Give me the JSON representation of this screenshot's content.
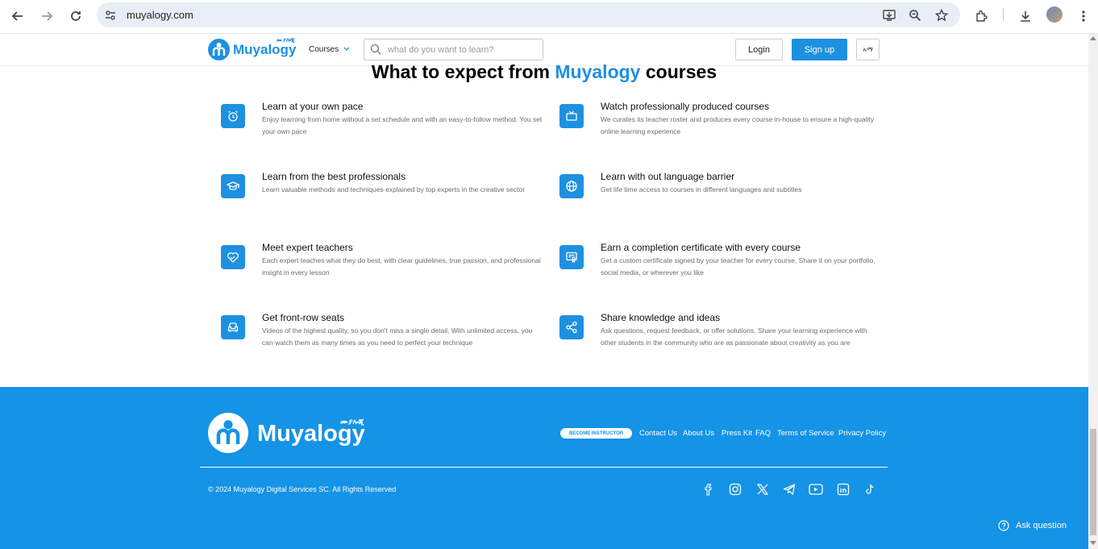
{
  "browser": {
    "url": "muyalogy.com"
  },
  "header": {
    "logo_text": "Muyalogy",
    "logo_subtext": "ሙያሎጂ",
    "courses_label": "Courses",
    "search_placeholder": "what do you want to learn?",
    "login_label": "Login",
    "signup_label": "Sign up",
    "language_label": "አማ"
  },
  "section": {
    "title_prefix": "What to expect from ",
    "title_accent": "Muyalogy",
    "title_suffix": " courses"
  },
  "features": [
    {
      "icon": "alarm-clock-icon",
      "title": "Learn at your own pace",
      "desc": "Enjoy learning from home without a set schedule and with an easy-to-follow method. You set your own pace"
    },
    {
      "icon": "tv-icon",
      "title": "Watch professionally produced courses",
      "desc": "We curates its teacher roster and produces every course in-house to ensure a high-quality online learning experience"
    },
    {
      "icon": "graduation-cap-icon",
      "title": "Learn from the best professionals",
      "desc": "Learn valuable methods and techniques explained by top experts in the creative sector"
    },
    {
      "icon": "globe-icon",
      "title": "Learn with out language barrier",
      "desc": "Get life time access to courses in different languages and subtitles"
    },
    {
      "icon": "heart-handshake-icon",
      "title": "Meet expert teachers",
      "desc": "Each expert teaches what they do best, with clear guidelines, true passion, and professional insight in every lesson"
    },
    {
      "icon": "certificate-icon",
      "title": "Earn a completion certificate with every course",
      "desc": "Get a custom certificate signed by your teacher for every course, Share it on your portfolio, social media, or wherever you like"
    },
    {
      "icon": "armchair-icon",
      "title": "Get front-row seats",
      "desc": "Videos of the highest quality, so you don't miss a single detail, With unlimited access, you can watch them as many times as you need to perfect your technique"
    },
    {
      "icon": "share-icon",
      "title": "Share knowledge and ideas",
      "desc": "Ask questions, request feedback, or offer solutions, Share your learning experience with other students in the community who are as passionate about creativity as you are"
    }
  ],
  "footer": {
    "logo_text": "Muyalogy",
    "logo_subtext": "ሙያሎጂ",
    "become_instructor": "BECOME INSTRUCTOR",
    "links": [
      "Contact Us",
      "About Us",
      "Press Kit",
      "FAQ",
      "Terms of Service",
      "Privacy Policy"
    ],
    "copyright": "© 2024 Muyalogy Digital Services SC. All Rights Reserved",
    "social_icons": [
      "facebook-icon",
      "instagram-icon",
      "x-twitter-icon",
      "telegram-icon",
      "youtube-icon",
      "linkedin-icon",
      "tiktok-icon"
    ],
    "ask_question": "Ask question"
  },
  "colors": {
    "brand": "#1e90e0",
    "footer_bg": "#1593e6"
  }
}
